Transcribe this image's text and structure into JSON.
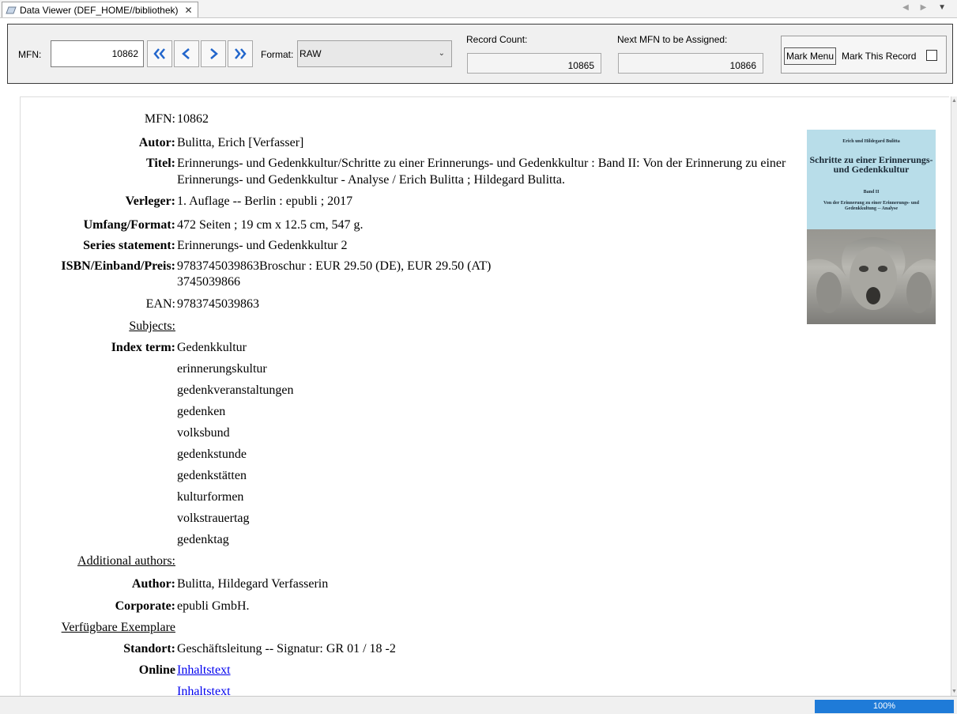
{
  "tab": {
    "title": "Data Viewer (DEF_HOME//bibliothek)",
    "close": "✕",
    "nav": "◀ ▶",
    "menu": "▼"
  },
  "toolbar": {
    "mfn_label": "MFN:",
    "mfn_value": "10862",
    "nav": [
      "first-record",
      "previous-record",
      "next-record",
      "last-record"
    ],
    "format_label": "Format:",
    "format_value": "RAW",
    "record_count_label": "Record Count:",
    "record_count_value": "10865",
    "next_mfn_label": "Next MFN to be Assigned:",
    "next_mfn_value": "10866",
    "mark_menu_label": "Mark Menu",
    "mark_this_label": "Mark This Record",
    "mark_this_checked": false
  },
  "record": {
    "mfn_key": "MFN:",
    "mfn": "10862",
    "autor_key": "Autor:",
    "autor": "Bulitta, Erich [Verfasser]",
    "titel_key": "Titel:",
    "titel": "Erinnerungs- und Gedenkkultur/Schritte zu einer Erinnerungs- und Gedenkkultur : Band II: Von der Erinnerung zu einer Erinnerungs- und Gedenkkultur - Analyse / Erich Bulitta ; Hildegard Bulitta.",
    "verleger_key": "Verleger:",
    "verleger": "1. Auflage -- Berlin : epubli ; 2017",
    "umfang_key": "Umfang/Format:",
    "umfang": "472 Seiten ; 19 cm x 12.5 cm, 547 g.",
    "series_key": "Series statement:",
    "series": "Erinnerungs- und Gedenkkultur 2",
    "isbn_key": "ISBN/Einband/Preis:",
    "isbn_line1": "9783745039863Broschur : EUR 29.50 (DE), EUR 29.50 (AT)",
    "isbn_line2": "3745039866",
    "ean_key": "EAN:",
    "ean": "9783745039863",
    "subjects_heading": "Subjects:",
    "index_key": "Index term:",
    "index_terms": [
      "Gedenkkultur",
      "erinnerungskultur",
      "gedenkveranstaltungen",
      "gedenken",
      "volksbund",
      "gedenkstunde",
      "gedenkstätten",
      "kulturformen",
      "volkstrauertag",
      "gedenktag"
    ],
    "additional_heading": "Additional authors:",
    "author_key": "Author:",
    "author": "Bulitta, Hildegard Verfasserin",
    "corporate_key": "Corporate:",
    "corporate": "epubli GmbH.",
    "verfuegbar_heading": "Verfügbare Exemplare",
    "standort_key": "Standort:",
    "standort": "Geschäftsleitung -- Signatur: GR 01 / 18 -2",
    "online_key": "Online",
    "online_links": [
      "Inhaltstext",
      "Inhaltstext"
    ]
  },
  "cover": {
    "authors": "Erich und Hildegard Bulitta",
    "title": "Schritte zu einer Erinnerungs- und Gedenkkultur",
    "band": "Band II",
    "subtitle": "Von der Erinnerung zu einer Erinnerungs- und Gedenkkultung -- Analyse"
  },
  "status": {
    "zoom": "100%"
  },
  "colors": {
    "accent": "#1f7bd8",
    "link": "#0000ee",
    "border": "#3a3a3a"
  }
}
